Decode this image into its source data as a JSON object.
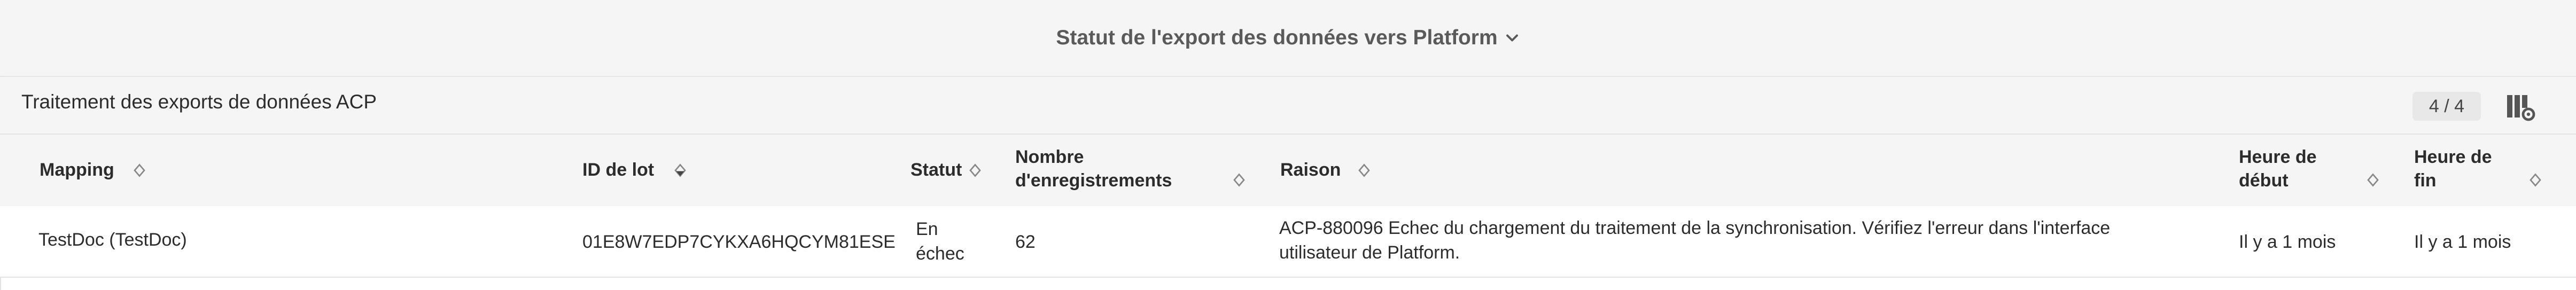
{
  "header": {
    "title": "Statut de l'export des données vers Platform"
  },
  "section": {
    "title": "Traitement des exports de données ACP",
    "counter": "4 / 4"
  },
  "table": {
    "columns": {
      "mapping": "Mapping",
      "batch_id": "ID de lot",
      "status": "Statut",
      "records_line1": "Nombre",
      "records_line2": "d'enregistrements",
      "reason": "Raison",
      "start_line1": "Heure de",
      "start_line2": "début",
      "end_line1": "Heure de",
      "end_line2": "fin"
    },
    "rows": [
      {
        "mapping": "TestDoc (TestDoc)",
        "batch_id": "01E8W7EDP7CYKXA6HQCYM81ESE",
        "status_line1": "En",
        "status_line2": "échec",
        "records": "62",
        "reason_line1": "ACP-880096 Echec du chargement du traitement de la synchronisation. Vérifiez l'erreur dans l'interface",
        "reason_line2": "utilisateur de Platform.",
        "start": "Il y a 1 mois",
        "end": "Il y a 1 mois"
      }
    ]
  }
}
